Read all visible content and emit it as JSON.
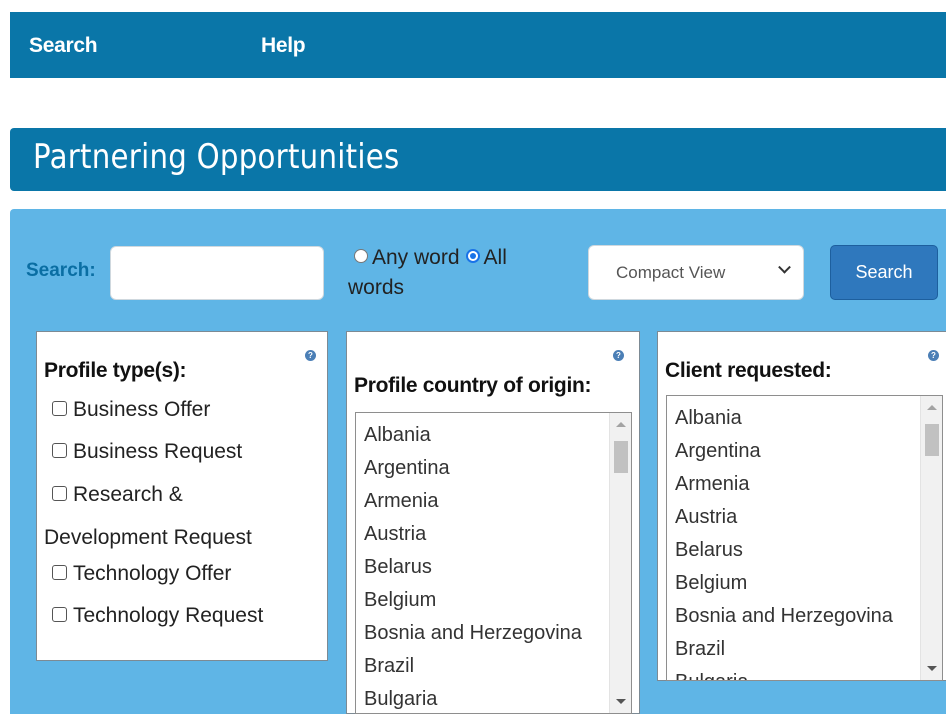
{
  "nav": {
    "search": "Search",
    "help": "Help"
  },
  "page_title": "Partnering Opportunities",
  "search": {
    "label": "Search:",
    "value": "",
    "placeholder": "",
    "mode_options": {
      "any": "Any word",
      "all": "All words",
      "selected": "All words"
    },
    "view_select": "Compact View",
    "button": "Search"
  },
  "profile_types": {
    "title": "Profile type(s):",
    "help": "?",
    "items": [
      {
        "label": "Business Offer"
      },
      {
        "label": "Business Request"
      },
      {
        "label": "Research &"
      },
      {
        "label": "Development Request"
      },
      {
        "label": "Technology Offer"
      },
      {
        "label": "Technology Request"
      }
    ]
  },
  "country_of_origin": {
    "title": "Profile country of origin:",
    "help": "?",
    "options": [
      "Albania",
      "Argentina",
      "Armenia",
      "Austria",
      "Belarus",
      "Belgium",
      "Bosnia and Herzegovina",
      "Brazil",
      "Bulgaria"
    ]
  },
  "client_requested": {
    "title": "Client requested:",
    "help": "?",
    "options": [
      "Albania",
      "Argentina",
      "Armenia",
      "Austria",
      "Belarus",
      "Belgium",
      "Bosnia and Herzegovina",
      "Brazil",
      "Bulgaria"
    ]
  },
  "colors": {
    "header": "#0a76a8",
    "panel": "#5fb5e6",
    "button": "#2f78bd"
  }
}
